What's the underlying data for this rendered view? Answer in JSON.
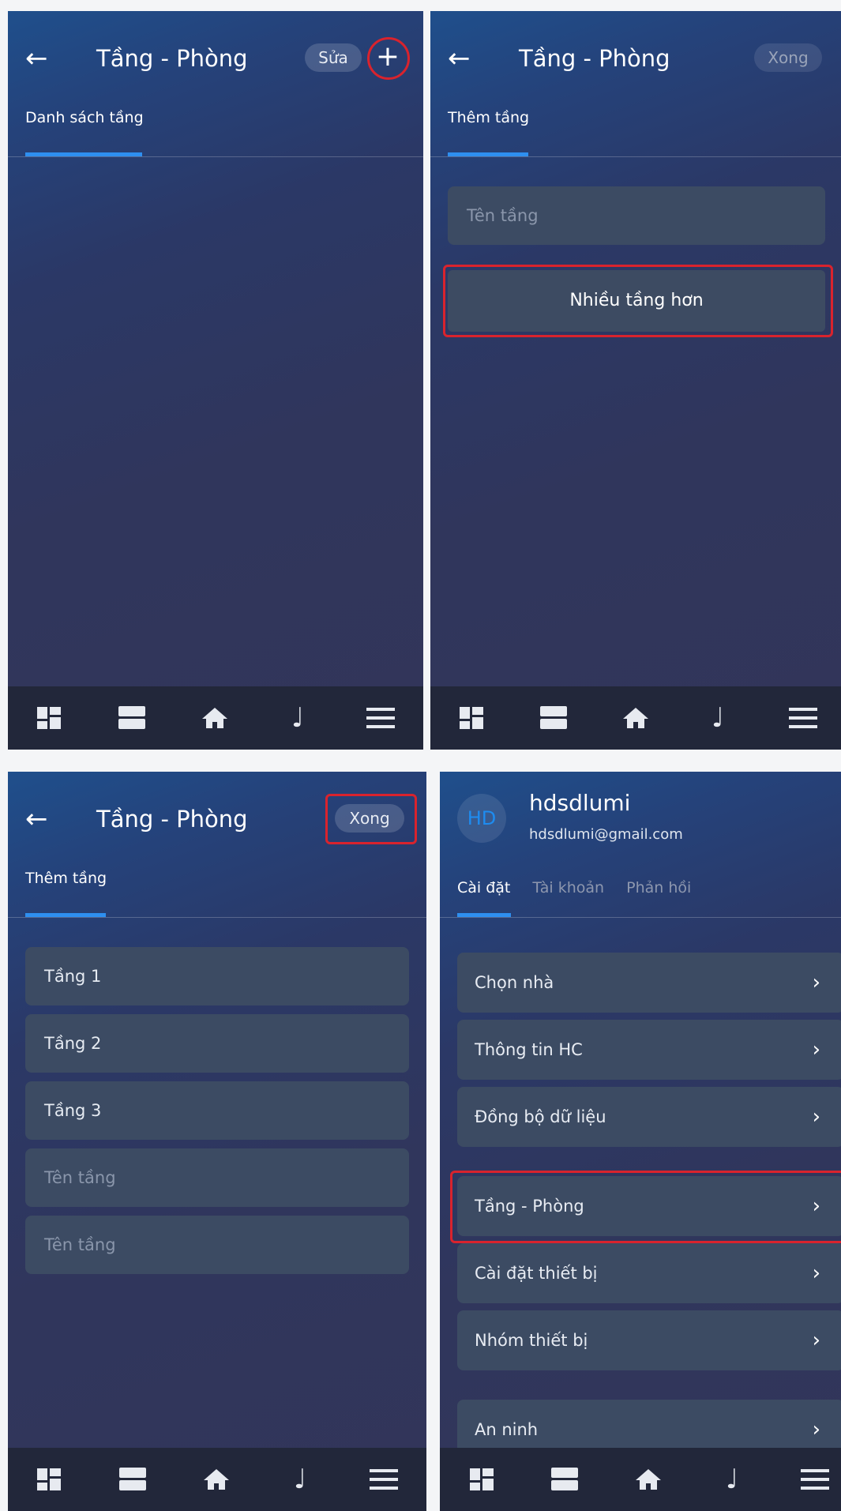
{
  "screens": [
    {
      "title": "Tầng - Phòng",
      "edit_label": "Sửa",
      "add_label": "+",
      "tab_label": "Danh sách tầng"
    },
    {
      "title": "Tầng - Phòng",
      "done_label": "Xong",
      "tab_label": "Thêm tầng",
      "floor_name_placeholder": "Tên tầng",
      "more_floors_label": "Nhiều tầng hơn"
    },
    {
      "title": "Tầng - Phòng",
      "done_label": "Xong",
      "tab_label": "Thêm tầng",
      "floors": [
        "Tầng 1",
        "Tầng 2",
        "Tầng 3"
      ],
      "floor_name_placeholder": "Tên tầng"
    },
    {
      "avatar_initials": "HD",
      "user_name": "hdsdlumi",
      "user_email": "hdsdlumi@gmail.com",
      "tabs": [
        "Cài đặt",
        "Tài khoản",
        "Phản hồi"
      ],
      "menu": [
        "Chọn nhà",
        "Thông tin HC",
        "Đồng bộ dữ liệu",
        "Tầng - Phòng",
        "Cài đặt thiết bị",
        "Nhóm thiết bị",
        "An ninh"
      ]
    }
  ],
  "back_icon": "arrow-left-icon",
  "chevron_icon": "chevron-right-icon",
  "nav_icons": [
    "dashboard-icon",
    "rows-icon",
    "home-icon",
    "music-icon",
    "menu-icon"
  ],
  "colors": {
    "accent": "#2e8ff0",
    "highlight": "#d9232d",
    "bg_top": "#1f4f8c",
    "bg_bottom": "#32355a",
    "navbar": "#22273a",
    "card": "#3c4b63"
  }
}
